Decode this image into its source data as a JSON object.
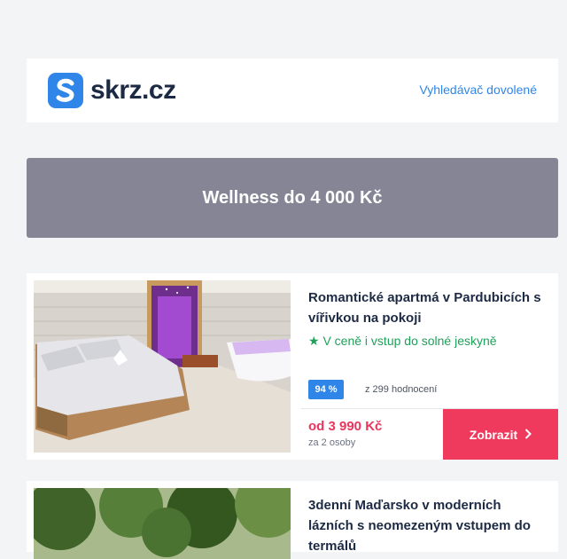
{
  "header": {
    "logo_text": "skrz.cz",
    "nav_link": "Vyhledávač dovolené"
  },
  "banner": {
    "title": "Wellness do 4 000 Kč"
  },
  "offers": [
    {
      "title": "Romantické apartmá v Pardubicích s vířivkou na pokoji",
      "perk_icon": "star-icon",
      "perk": "V ceně i vstup do solné jeskyně",
      "rating": "94 %",
      "reviews": "z 299 hodnocení",
      "price": "od 3 990 Kč",
      "persons": "za 2 osoby",
      "cta": "Zobrazit"
    },
    {
      "title": "3denní Maďarsko v moderních lázních s neomezeným vstupem do termálů"
    }
  ],
  "colors": {
    "brand": "#2f86e8",
    "banner": "#868596",
    "price": "#e8365d",
    "cta": "#ef3a5d",
    "perk": "#1fa05a"
  }
}
